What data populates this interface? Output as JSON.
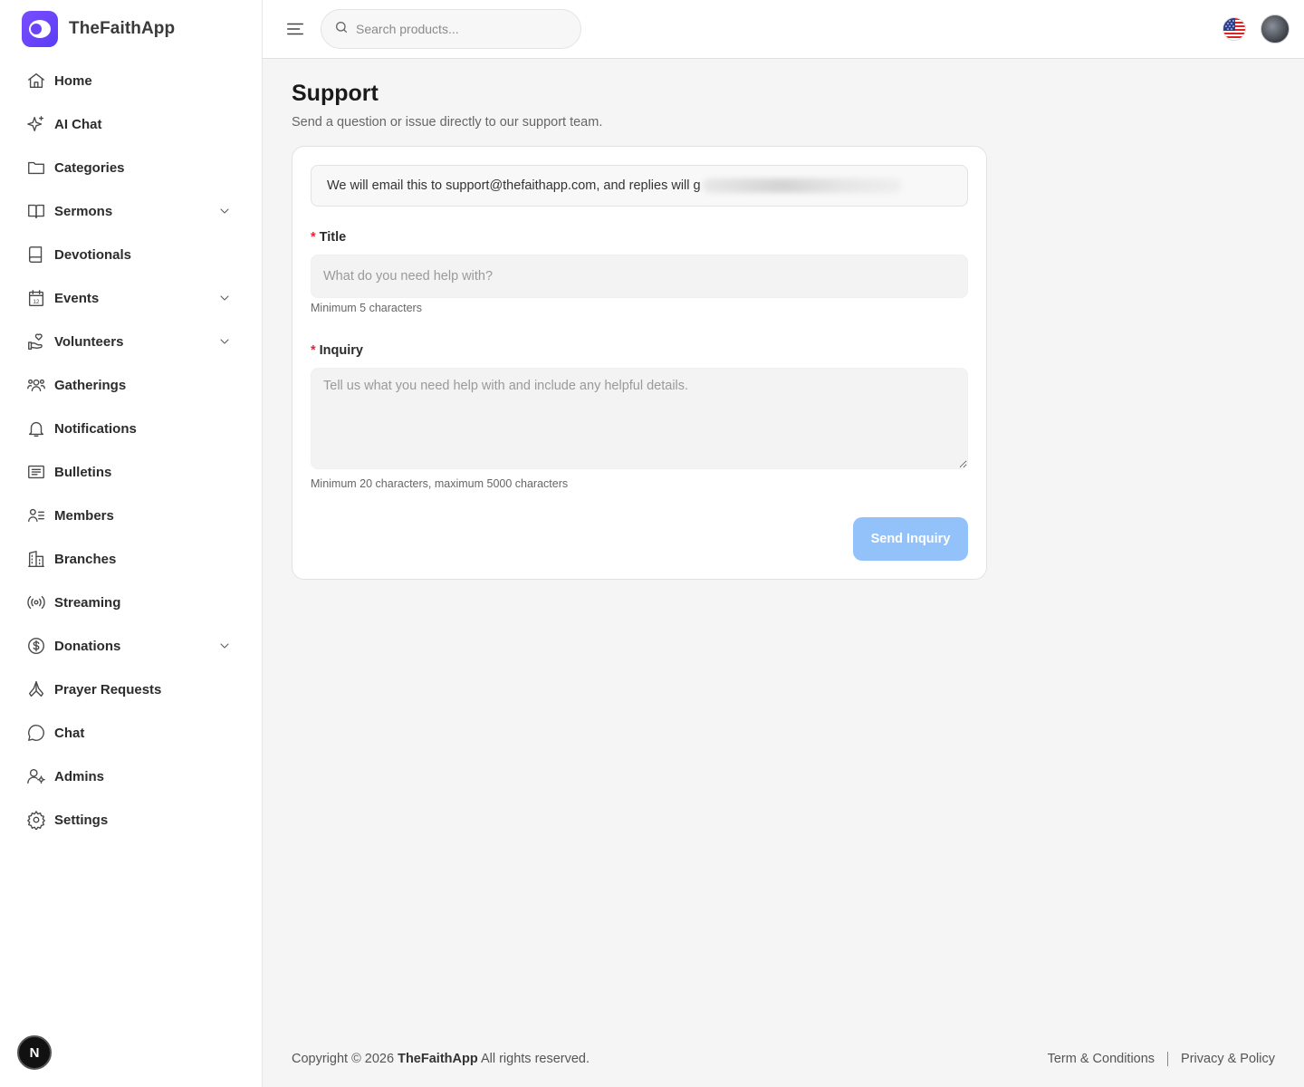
{
  "app": {
    "name": "TheFaithApp"
  },
  "sidebar": {
    "items": [
      {
        "label": "Home",
        "icon": "home-icon",
        "expandable": false
      },
      {
        "label": "AI Chat",
        "icon": "sparkles-icon",
        "expandable": false
      },
      {
        "label": "Categories",
        "icon": "folder-icon",
        "expandable": false
      },
      {
        "label": "Sermons",
        "icon": "book-open-icon",
        "expandable": true
      },
      {
        "label": "Devotionals",
        "icon": "book-icon",
        "expandable": false
      },
      {
        "label": "Events",
        "icon": "calendar-icon",
        "expandable": true
      },
      {
        "label": "Volunteers",
        "icon": "hand-heart-icon",
        "expandable": true
      },
      {
        "label": "Gatherings",
        "icon": "group-icon",
        "expandable": false
      },
      {
        "label": "Notifications",
        "icon": "bell-icon",
        "expandable": false
      },
      {
        "label": "Bulletins",
        "icon": "newspaper-icon",
        "expandable": false
      },
      {
        "label": "Members",
        "icon": "user-list-icon",
        "expandable": false
      },
      {
        "label": "Branches",
        "icon": "building-icon",
        "expandable": false
      },
      {
        "label": "Streaming",
        "icon": "broadcast-icon",
        "expandable": false
      },
      {
        "label": "Donations",
        "icon": "dollar-circle-icon",
        "expandable": true
      },
      {
        "label": "Prayer Requests",
        "icon": "praying-hands-icon",
        "expandable": false
      },
      {
        "label": "Chat",
        "icon": "chat-bubble-icon",
        "expandable": false
      },
      {
        "label": "Admins",
        "icon": "user-gear-icon",
        "expandable": false
      },
      {
        "label": "Settings",
        "icon": "gear-icon",
        "expandable": false
      }
    ],
    "badge": "N"
  },
  "header": {
    "search_placeholder": "Search products..."
  },
  "page": {
    "title": "Support",
    "subtitle": "Send a question or issue directly to our support team.",
    "notice": "We will email this to support@thefaithapp.com, and replies will g",
    "title_field": {
      "required_mark": "*",
      "label": "Title",
      "placeholder": "What do you need help with?",
      "value": "",
      "hint": "Minimum 5 characters"
    },
    "inquiry_field": {
      "required_mark": "*",
      "label": "Inquiry",
      "placeholder": "Tell us what you need help with and include any helpful details.",
      "value": "",
      "hint": "Minimum 20 characters, maximum 5000 characters"
    },
    "submit_label": "Send Inquiry"
  },
  "footer": {
    "copyright_prefix": "Copyright © 2026",
    "brand": "TheFaithApp",
    "copyright_suffix": "All rights reserved.",
    "terms": "Term & Conditions",
    "privacy": "Privacy & Policy"
  },
  "colors": {
    "brand": "#6244f5",
    "button_disabled": "#93c2fb",
    "required": "#e22233"
  }
}
